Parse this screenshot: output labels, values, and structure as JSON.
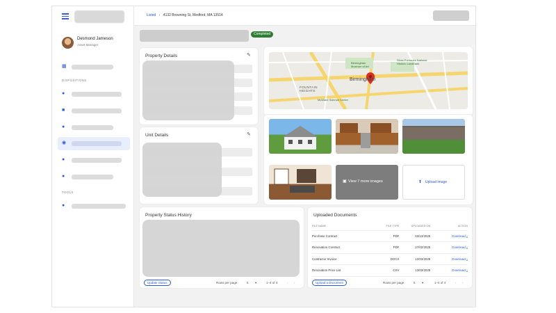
{
  "user": {
    "name": "Desmond Jameson",
    "role": "Asset Manager"
  },
  "sidebar": {
    "section_dispositions": "DISPOSITIONS",
    "section_tools": "TOOLS"
  },
  "breadcrumb": {
    "root": "Listed",
    "separator": "›",
    "address": "4132 Browning St, Medford, MA 13514"
  },
  "status": {
    "label": "Completed",
    "color": "#2e7d32"
  },
  "property_details": {
    "title": "Property Details"
  },
  "unit_details": {
    "title": "Unit Details"
  },
  "map": {
    "labels": [
      {
        "text": "Birmingham Museum of Art"
      },
      {
        "text": "Sloss Furnaces National Historic Landmark"
      },
      {
        "text": "Birmingham"
      },
      {
        "text": "FOUNTAIN HEIGHTS"
      },
      {
        "text": "McWane Science Center"
      }
    ]
  },
  "gallery": {
    "more_label": "View 7 more images",
    "upload_label": "Upload Image"
  },
  "status_history": {
    "title": "Property Status History",
    "update_button": "Update Status",
    "rows_per_page_label": "Rows per page",
    "rows_per_page": "5",
    "range": "1–4 of 4"
  },
  "documents": {
    "title": "Uploaded Documents",
    "columns": [
      "FILE NAME",
      "FILE TYPE",
      "UPLOADED ON",
      "ACTION"
    ],
    "rows": [
      {
        "name": "Purchase Contract",
        "type": "PDF",
        "date": "03/13/2025",
        "action": "Download"
      },
      {
        "name": "Renovation Contract",
        "type": "PDF",
        "date": "27/02/2025",
        "action": "Download"
      },
      {
        "name": "Contractor Invoice",
        "type": "DOCX",
        "date": "12/03/2025",
        "action": "Download"
      },
      {
        "name": "Renovation Price List",
        "type": "CSV",
        "date": "13/03/2025",
        "action": "Download"
      }
    ],
    "upload_button": "Upload a Document",
    "rows_per_page_label": "Rows per page",
    "rows_per_page": "5",
    "range": "1–4 of 4"
  },
  "colors": {
    "accent": "#2a5bd7",
    "success": "#2e7d32",
    "map_pin": "#d93025"
  }
}
